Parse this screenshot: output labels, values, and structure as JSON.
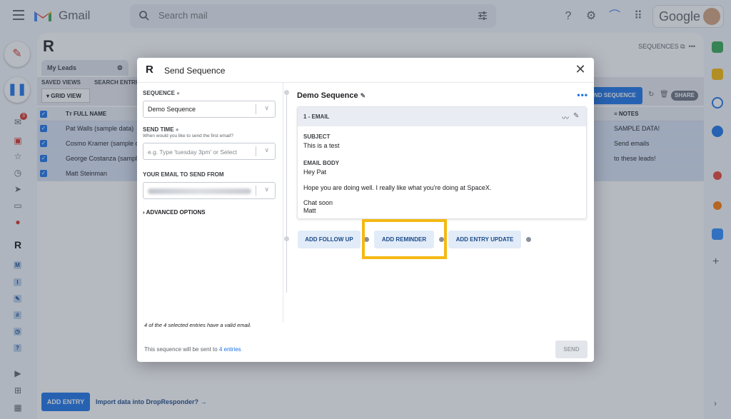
{
  "gmail": {
    "brand": "Gmail",
    "search_placeholder": "Search mail",
    "google_label": "Google",
    "inbox_badge": "3"
  },
  "app": {
    "sequences_link": "SEQUENCES",
    "tab_label": "My Leads",
    "saved_views_label": "SAVED VIEWS",
    "search_entries_label": "SEARCH ENTRI",
    "grid_view_label": "GRID VIEW",
    "send_sequence_label": "ND SEQUENCE",
    "share_label": "SHARE",
    "col_full_name": "FULL NAME",
    "col_notes": "NOTES",
    "rows": [
      {
        "name": "Pat Walls (sample data)",
        "notes": "SAMPLE DATA!"
      },
      {
        "name": "Cosmo Kramer (sample da",
        "notes": "Send emails"
      },
      {
        "name": "George Costanza (sample",
        "notes": "to these leads!"
      },
      {
        "name": "Matt Steinman",
        "notes": ""
      }
    ],
    "add_entry_label": "ADD ENTRY",
    "import_link": "Import data into DropResponder? →"
  },
  "modal": {
    "title": "Send Sequence",
    "sequence_label": "SEQUENCE",
    "sequence_value": "Demo Sequence",
    "send_time_label": "SEND TIME",
    "send_time_sub": "When would you like to send the first email?",
    "send_time_placeholder": "e.g. Type 'tuesday 3pm' or Select",
    "from_label": "YOUR EMAIL TO SEND FROM",
    "advanced_label": "ADVANCED OPTIONS",
    "valid_note": "4 of the 4 selected entries have a valid email.",
    "sent_prefix": "This sequence will be sent to ",
    "sent_link": "4 entries",
    "send_button": "SEND",
    "sequence_name": "Demo Sequence",
    "email_step": {
      "header": "1 - EMAIL",
      "subject_label": "SUBJECT",
      "subject": "This is a test",
      "body_label": "EMAIL BODY",
      "body_greeting": "Hey Pat",
      "body_line": "Hope you are doing well. I really like what you're doing at SpaceX.",
      "body_closing": "Chat soon",
      "body_sign": "Matt"
    },
    "actions": {
      "follow_up": "ADD FOLLOW UP",
      "reminder": "ADD REMINDER",
      "entry_update": "ADD ENTRY UPDATE"
    }
  },
  "colors": {
    "accent": "#1a73e8",
    "highlight": "#f5b914"
  }
}
